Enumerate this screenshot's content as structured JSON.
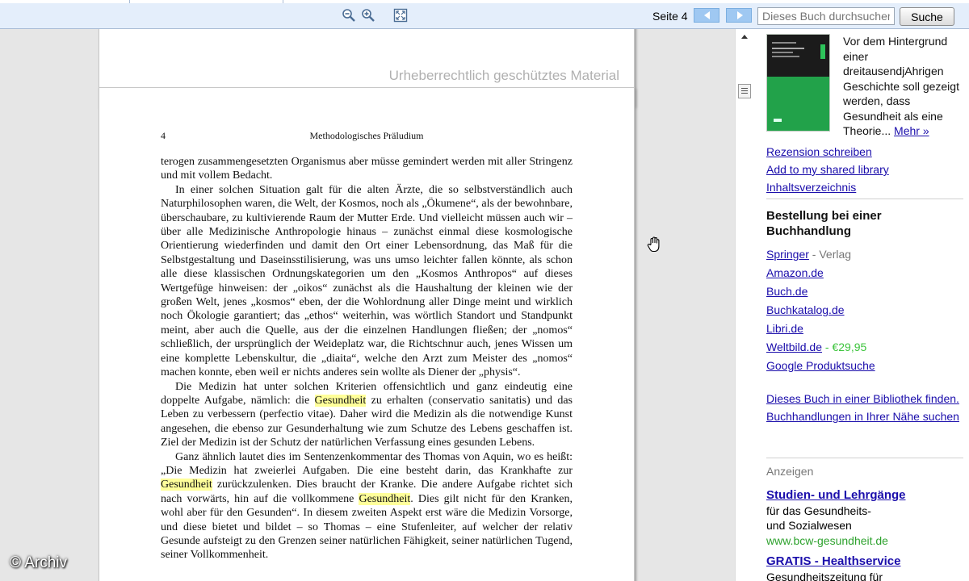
{
  "toolbar": {
    "page_label": "Seite 4",
    "search_placeholder": "Dieses Buch durchsuchen",
    "search_button": "Suche"
  },
  "viewer": {
    "watermark": "Urheberrechtlich geschütztes Material",
    "page_number": "4",
    "running_head": "Methodologisches Präludium",
    "paragraphs": [
      {
        "indent": false,
        "parts": [
          "terogen zusammengesetzten Organismus aber müsse gemindert werden mit aller Stringenz und mit vollem Bedacht."
        ]
      },
      {
        "indent": true,
        "parts": [
          "In einer solchen Situation galt für die alten Ärzte, die so selbstverständlich auch Naturphilosophen waren, die Welt, der Kosmos, noch als „Ökumene“, als der bewohnbare, überschaubare, zu kultivierende Raum der Mutter Erde. Und vielleicht müssen auch wir – über alle Medizinische Anthropologie hinaus – zunächst einmal diese kosmologische Orientierung wiederfinden und damit den Ort einer Lebensordnung, das Maß für die Selbstgestaltung und Daseinsstilisierung, was uns umso leichter fallen könnte, als schon alle diese klassischen Ordnungskategorien um den „Kosmos Anthropos“ auf dieses Wertgefüge hinweisen: der „oikos“ zunächst als die Haushaltung der kleinen wie der großen Welt, jenes „kosmos“ eben, der die Wohlordnung aller Dinge meint und wirklich noch Ökologie garantiert; das „ethos“ weiterhin, was wörtlich Standort und Standpunkt meint, aber auch die Quelle, aus der die einzelnen Handlungen fließen; der „nomos“ schließlich, der ursprünglich der Weideplatz war, die Richtschnur auch, jenes Wissen um eine komplette Lebenskultur, die „diaita“, welche den Arzt zum Meister des „nomos“ machen konnte, eben weil er nichts anderes sein wollte als Diener der „physis“."
        ]
      },
      {
        "indent": true,
        "parts": [
          "Die Medizin hat unter solchen Kriterien offensichtlich und ganz eindeutig eine doppelte Aufgabe, nämlich: die ",
          "Gesundheit",
          " zu erhalten (conservatio sanitatis) und das Leben zu verbessern (perfectio vitae). Daher wird die Medizin als die notwendige Kunst angesehen, die ebenso zur Gesunderhaltung wie zum Schutze des Lebens geschaffen ist. Ziel der Medizin ist der Schutz der natürlichen Verfassung eines gesunden Lebens."
        ]
      },
      {
        "indent": true,
        "parts": [
          "Ganz ähnlich lautet dies im Sentenzenkommentar des Thomas von Aquin, wo es heißt: „Die Medizin hat zweierlei Aufgaben. Die eine besteht darin, das Krankhafte zur ",
          "Gesundheit",
          " zurückzulenken. Dies braucht der Kranke. Die andere Aufgabe richtet sich nach vorwärts, hin auf die vollkommene ",
          "Gesundheit",
          ". Dies gilt nicht für den Kranken, wohl aber für den Gesunden“. In diesem zweiten Aspekt erst wäre die Medizin Vorsorge, und diese bietet und bildet – so Thomas – eine Stufenleiter, auf welcher der relativ Gesunde aufsteigt zu den Grenzen seiner natürlichen Fähigkeit, seiner natürlichen Tugend, seiner Vollkommenheit."
        ]
      }
    ],
    "copyright": "© Archiv"
  },
  "sidebar": {
    "description": "Vor dem Hintergrund einer dreitausendjAhrigen Geschichte soll gezeigt werden, dass Gesundheit als eine Theorie...",
    "more_link": "Mehr »",
    "links": [
      "Rezension schreiben",
      "Add to my shared library",
      "Inhaltsverzeichnis"
    ],
    "order_title": "Bestellung bei einer Buchhandlung",
    "shops": [
      {
        "name": "Springer",
        "extra": " - Verlag",
        "extra_type": "muted"
      },
      {
        "name": "Amazon.de"
      },
      {
        "name": "Buch.de"
      },
      {
        "name": "Buchkatalog.de"
      },
      {
        "name": "Libri.de"
      },
      {
        "name": "Weltbild.de",
        "extra": " - €29,95",
        "extra_type": "price"
      },
      {
        "name": "Google Produktsuche"
      }
    ],
    "library_links": [
      "Dieses Buch in einer Bibliothek finden.",
      "Buchhandlungen in Ihrer Nähe suchen"
    ],
    "ads_label": "Anzeigen",
    "ads": [
      {
        "title": "Studien- und Lehrgänge",
        "lines": [
          "für das Gesundheits-",
          "und Sozialwesen"
        ],
        "url": "www.bcw-gesundheit.de"
      },
      {
        "title": "GRATIS - Healthservice",
        "lines": [
          "Gesundheitszeitung für"
        ],
        "url": ""
      }
    ]
  }
}
